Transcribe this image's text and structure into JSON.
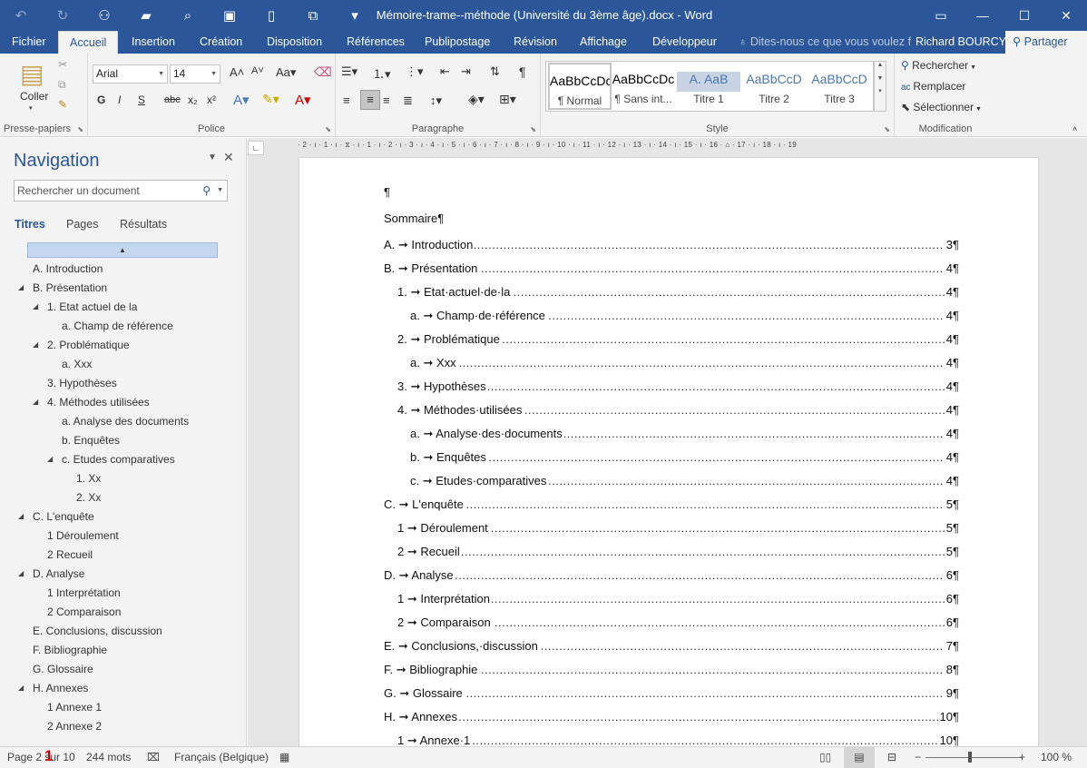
{
  "app": {
    "window_title": "Mémoire-trame--méthode (Université du 3ème âge).docx - Word",
    "qat": [
      {
        "name": "undo-icon",
        "glyph": "↶"
      },
      {
        "name": "redo-icon",
        "glyph": "↻"
      },
      {
        "name": "people-icon",
        "glyph": "⚇"
      },
      {
        "name": "open-folder-icon",
        "glyph": "▰"
      },
      {
        "name": "print-preview-icon",
        "glyph": "⌕"
      },
      {
        "name": "save-icon",
        "glyph": "▣"
      },
      {
        "name": "new-document-icon",
        "glyph": "▯"
      },
      {
        "name": "touch-mode-icon",
        "glyph": "⧉"
      },
      {
        "name": "customize-qat-icon",
        "glyph": "▾"
      }
    ],
    "window_controls": {
      "ribbon_options": "▭",
      "minimize": "—",
      "maximize": "☐",
      "close": "✕"
    }
  },
  "tabs": [
    "Fichier",
    "Accueil",
    "Insertion",
    "Création",
    "Disposition",
    "Références",
    "Publipostage",
    "Révision",
    "Affichage",
    "Développeur"
  ],
  "active_tab": "Accueil",
  "tell_me": "Dites-nous ce que vous voulez fa",
  "user": "Richard BOURCY",
  "share": "Partager",
  "ribbon": {
    "clipboard": {
      "paste": "Coller",
      "label": "Presse-papiers"
    },
    "font": {
      "name": "Arial",
      "size": "14",
      "label": "Police",
      "buttons": [
        "G",
        "I",
        "S",
        "abc",
        "x₂",
        "x²"
      ]
    },
    "paragraph": {
      "label": "Paragraphe"
    },
    "styles": {
      "label": "Style",
      "items": [
        {
          "preview": "AaBbCcDc",
          "name": "¶ Normal",
          "color": "#000000"
        },
        {
          "preview": "AaBbCcDc",
          "name": "¶ Sans int...",
          "color": "#000000"
        },
        {
          "preview": "A. AaB",
          "name": "Titre 1",
          "color": "#4a78b5"
        },
        {
          "preview": "AaBbCcD",
          "name": "Titre 2",
          "color": "#4a78b5"
        },
        {
          "preview": "AaBbCcD",
          "name": "Titre 3",
          "color": "#4a78b5"
        }
      ]
    },
    "editing": {
      "label": "Modification",
      "find": "Rechercher",
      "replace": "Remplacer",
      "select": "Sélectionner"
    }
  },
  "navigation": {
    "title": "Navigation",
    "search_placeholder": "Rechercher un document",
    "tabs": [
      "Titres",
      "Pages",
      "Résultats"
    ],
    "items": [
      {
        "label": "A. Introduction",
        "level": 0,
        "expand": false
      },
      {
        "label": "B. Présentation",
        "level": 0,
        "expand": true
      },
      {
        "label": "1. Etat actuel de la",
        "level": 1,
        "expand": true
      },
      {
        "label": "a. Champ de référence",
        "level": 2,
        "expand": false
      },
      {
        "label": "2. Problématique",
        "level": 1,
        "expand": true
      },
      {
        "label": "a. Xxx",
        "level": 2,
        "expand": false
      },
      {
        "label": "3. Hypothèses",
        "level": 1,
        "expand": false
      },
      {
        "label": "4. Méthodes utilisées",
        "level": 1,
        "expand": true
      },
      {
        "label": "a. Analyse des documents",
        "level": 2,
        "expand": false
      },
      {
        "label": "b. Enquêtes",
        "level": 2,
        "expand": false
      },
      {
        "label": "c. Etudes comparatives",
        "level": 2,
        "expand": true
      },
      {
        "label": "1. Xx",
        "level": 3,
        "expand": false
      },
      {
        "label": "2. Xx",
        "level": 3,
        "expand": false
      },
      {
        "label": "C. L'enquête",
        "level": 0,
        "expand": true
      },
      {
        "label": "1 Déroulement",
        "level": 1,
        "expand": false
      },
      {
        "label": "2 Recueil",
        "level": 1,
        "expand": false
      },
      {
        "label": "D. Analyse",
        "level": 0,
        "expand": true
      },
      {
        "label": "1 Interprétation",
        "level": 1,
        "expand": false
      },
      {
        "label": "2 Comparaison",
        "level": 1,
        "expand": false
      },
      {
        "label": "E. Conclusions, discussion",
        "level": 0,
        "expand": false
      },
      {
        "label": "F. Bibliographie",
        "level": 0,
        "expand": false
      },
      {
        "label": "G. Glossaire",
        "level": 0,
        "expand": false
      },
      {
        "label": "H. Annexes",
        "level": 0,
        "expand": true
      },
      {
        "label": "1 Annexe 1",
        "level": 1,
        "expand": false
      },
      {
        "label": "2 Annexe 2",
        "level": 1,
        "expand": false
      }
    ]
  },
  "ruler_text": "· 2 · ı · 1 · ı · ⧖ · ı · 1 · ı · 2 · ı · 3 · ı · 4 · ı · 5 · ı · 6 · ı · 7 · ı · 8 · ı · 9 · ı · 10 · ı · 11 · ı · 12 · ı · 13 · ı · 14 · ı · 15 · ı · 16 · ⌂ · 17 · ı · 18 · ı · 19",
  "document": {
    "first_para": "¶",
    "heading": "Sommaire¶",
    "toc": [
      {
        "num": "A.",
        "text": "Introduction",
        "page": "3¶",
        "level": 0
      },
      {
        "num": "B.",
        "text": "Présentation",
        "page": "4¶",
        "level": 0
      },
      {
        "num": "1.",
        "text": "Etat·actuel·de·la",
        "page": "4¶",
        "level": 1
      },
      {
        "num": "a.",
        "text": "Champ·de·référence",
        "page": "4¶",
        "level": 2
      },
      {
        "num": "2.",
        "text": "Problématique",
        "page": "4¶",
        "level": 1
      },
      {
        "num": "a.",
        "text": "Xxx",
        "page": "4¶",
        "level": 2
      },
      {
        "num": "3.",
        "text": "Hypothèses",
        "page": "4¶",
        "level": 1
      },
      {
        "num": "4.",
        "text": "Méthodes·utilisées",
        "page": "4¶",
        "level": 1
      },
      {
        "num": "a.",
        "text": "Analyse·des·documents",
        "page": "4¶",
        "level": 2
      },
      {
        "num": "b.",
        "text": "Enquêtes",
        "page": "4¶",
        "level": 2
      },
      {
        "num": "c.",
        "text": "Etudes·comparatives",
        "page": "4¶",
        "level": 2
      },
      {
        "num": "C.",
        "text": "L'enquête",
        "page": "5¶",
        "level": 0
      },
      {
        "num": "1",
        "text": "Déroulement",
        "page": "5¶",
        "level": 1
      },
      {
        "num": "2",
        "text": "Recueil",
        "page": "5¶",
        "level": 1
      },
      {
        "num": "D.",
        "text": "Analyse",
        "page": "6¶",
        "level": 0
      },
      {
        "num": "1",
        "text": "Interprétation",
        "page": "6¶",
        "level": 1
      },
      {
        "num": "2",
        "text": "Comparaison",
        "page": "6¶",
        "level": 1
      },
      {
        "num": "E.",
        "text": "Conclusions,·discussion",
        "page": "7¶",
        "level": 0
      },
      {
        "num": "F.",
        "text": "Bibliographie",
        "page": "8¶",
        "level": 0
      },
      {
        "num": "G.",
        "text": "Glossaire",
        "page": "9¶",
        "level": 0
      },
      {
        "num": "H.",
        "text": "Annexes",
        "page": "10¶",
        "level": 0
      },
      {
        "num": "1",
        "text": "Annexe·1",
        "page": "10¶",
        "level": 1
      }
    ]
  },
  "status": {
    "page": "Page 2 sur 10",
    "marker": "1",
    "words": "244 mots",
    "language": "Français (Belgique)",
    "zoom": "100 %",
    "zoom_level": 1.0
  }
}
